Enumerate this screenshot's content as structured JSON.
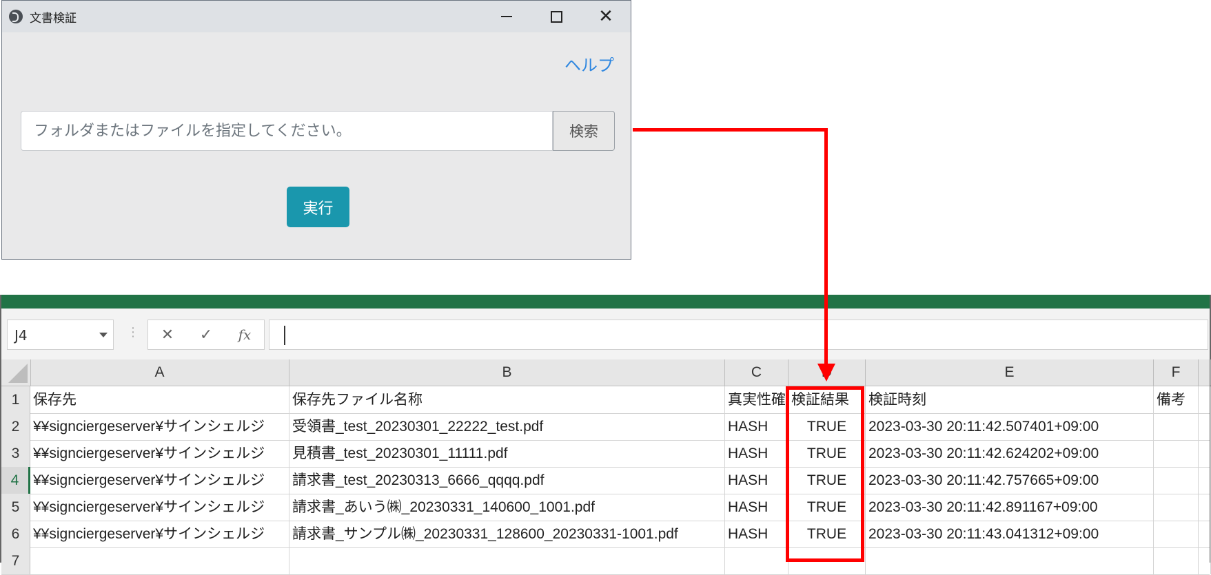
{
  "dialog": {
    "title": "文書検証",
    "help_link": "ヘルプ",
    "path_placeholder": "フォルダまたはファイルを指定してください。",
    "search_label": "検索",
    "run_label": "実行"
  },
  "excel": {
    "name_box": "J4",
    "formula_value": "",
    "accent_color": "#217346",
    "column_headers": [
      "A",
      "B",
      "C",
      "D",
      "E",
      "F"
    ],
    "row_numbers": [
      "1",
      "2",
      "3",
      "4",
      "5",
      "6",
      "7"
    ],
    "active_row": "4",
    "rows": [
      [
        "保存先",
        "保存先ファイル名称",
        "真実性確",
        "検証結果",
        "検証時刻",
        "備考"
      ],
      [
        "¥¥signciergeserver¥サインシェルジ",
        "受領書_test_20230301_22222_test.pdf",
        "HASH",
        "TRUE",
        "2023-03-30 20:11:42.507401+09:00",
        ""
      ],
      [
        "¥¥signciergeserver¥サインシェルジ",
        "見積書_test_20230301_11111.pdf",
        "HASH",
        "TRUE",
        "2023-03-30 20:11:42.624202+09:00",
        ""
      ],
      [
        "¥¥signciergeserver¥サインシェルジ",
        "請求書_test_20230313_6666_qqqq.pdf",
        "HASH",
        "TRUE",
        "2023-03-30 20:11:42.757665+09:00",
        ""
      ],
      [
        "¥¥signciergeserver¥サインシェルジ",
        "請求書_あいう㈱_20230331_140600_1001.pdf",
        "HASH",
        "TRUE",
        "2023-03-30 20:11:42.891167+09:00",
        ""
      ],
      [
        "¥¥signciergeserver¥サインシェルジ",
        "請求書_サンプル㈱_20230331_128600_20230331-1001.pdf",
        "HASH",
        "TRUE",
        "2023-03-30 20:11:43.041312+09:00",
        ""
      ]
    ]
  },
  "annotation": {
    "color": "#ff0000"
  }
}
